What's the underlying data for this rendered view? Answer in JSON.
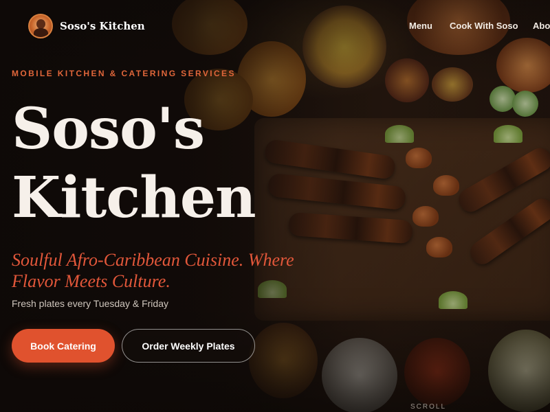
{
  "nav": {
    "brand": "Soso's Kitchen",
    "links": [
      "Menu",
      "Cook With Soso",
      "About"
    ]
  },
  "hero": {
    "eyebrow": "MOBILE KITCHEN & CATERING SERVICES",
    "title_line1": "Soso's",
    "title_line2": "Kitchen",
    "tagline": "Soulful Afro-Caribbean Cuisine. Where Flavor Meets Culture.",
    "subline": "Fresh plates every Tuesday & Friday",
    "primary_button": "Book Catering",
    "secondary_button": "Order Weekly Plates",
    "scroll_hint": "SCROLL"
  },
  "colors": {
    "accent": "#e0522e",
    "eyebrow": "#e0663a",
    "tagline": "#e2573a",
    "background": "#140d0a"
  },
  "icons": {
    "logo": "chef-portrait-logo-icon"
  }
}
